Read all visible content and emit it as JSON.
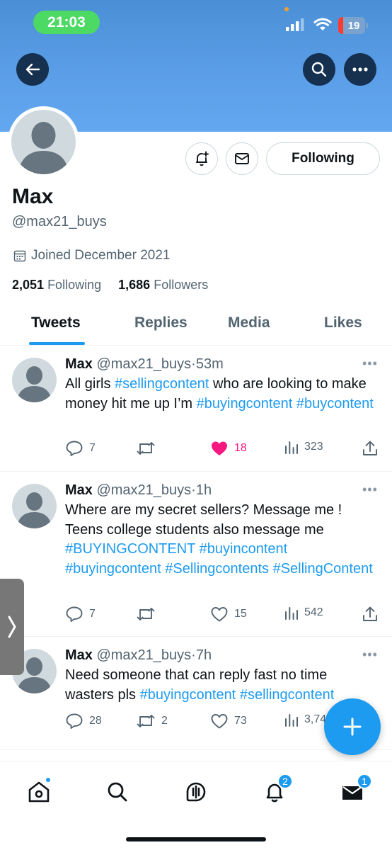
{
  "status_bar": {
    "time": "21:03",
    "battery": "19"
  },
  "profile": {
    "name": "Max",
    "handle": "@max21_buys",
    "joined": "Joined December 2021",
    "following_count": "2,051",
    "following_label": "Following",
    "followers_count": "1,686",
    "followers_label": "Followers",
    "follow_button": "Following"
  },
  "tabs": [
    {
      "label": "Tweets",
      "active": true
    },
    {
      "label": "Replies",
      "active": false
    },
    {
      "label": "Media",
      "active": false
    },
    {
      "label": "Likes",
      "active": false
    }
  ],
  "tweets": [
    {
      "name": "Max",
      "handle": "@max21_buys",
      "time": "53m",
      "text_parts": [
        {
          "t": "All girls ",
          "tag": false
        },
        {
          "t": "#sellingcontent",
          "tag": true
        },
        {
          "t": " who are looking to make money hit me up I’m ",
          "tag": false
        },
        {
          "t": "#buyingcontent",
          "tag": true
        },
        {
          "t": " ",
          "tag": false
        },
        {
          "t": "#buycontent",
          "tag": true
        }
      ],
      "replies": "7",
      "retweets": "",
      "likes": "18",
      "liked": true,
      "views": "323"
    },
    {
      "name": "Max",
      "handle": "@max21_buys",
      "time": "1h",
      "text_parts": [
        {
          "t": "Where are my secret sellers? Message me ! Teens college students also message me ",
          "tag": false
        },
        {
          "t": "#BUYINGCONTENT",
          "tag": true
        },
        {
          "t": " ",
          "tag": false
        },
        {
          "t": "#buyincontent",
          "tag": true
        },
        {
          "t": " ",
          "tag": false
        },
        {
          "t": "#buyingcontent",
          "tag": true
        },
        {
          "t": " ",
          "tag": false
        },
        {
          "t": "#Sellingcontents",
          "tag": true
        },
        {
          "t": " ",
          "tag": false
        },
        {
          "t": "#SellingContent",
          "tag": true
        }
      ],
      "replies": "7",
      "retweets": "",
      "likes": "15",
      "liked": false,
      "views": "542"
    },
    {
      "name": "Max",
      "handle": "@max21_buys",
      "time": "7h",
      "text_parts": [
        {
          "t": "Need someone that can reply fast no time wasters pls ",
          "tag": false
        },
        {
          "t": "#buyingcontent",
          "tag": true
        },
        {
          "t": " ",
          "tag": false
        },
        {
          "t": "#sellingcontent",
          "tag": true
        }
      ],
      "replies": "28",
      "retweets": "2",
      "likes": "73",
      "liked": false,
      "views": "3,74"
    }
  ],
  "bottom_nav": {
    "items": [
      "home-icon",
      "search-icon",
      "spaces-icon",
      "notifications-icon",
      "messages-icon"
    ],
    "notifications_badge": "2",
    "messages_badge": "1"
  },
  "colors": {
    "accent": "#1d9bf0",
    "like": "#f91880",
    "banner": "#5b9ee8"
  }
}
